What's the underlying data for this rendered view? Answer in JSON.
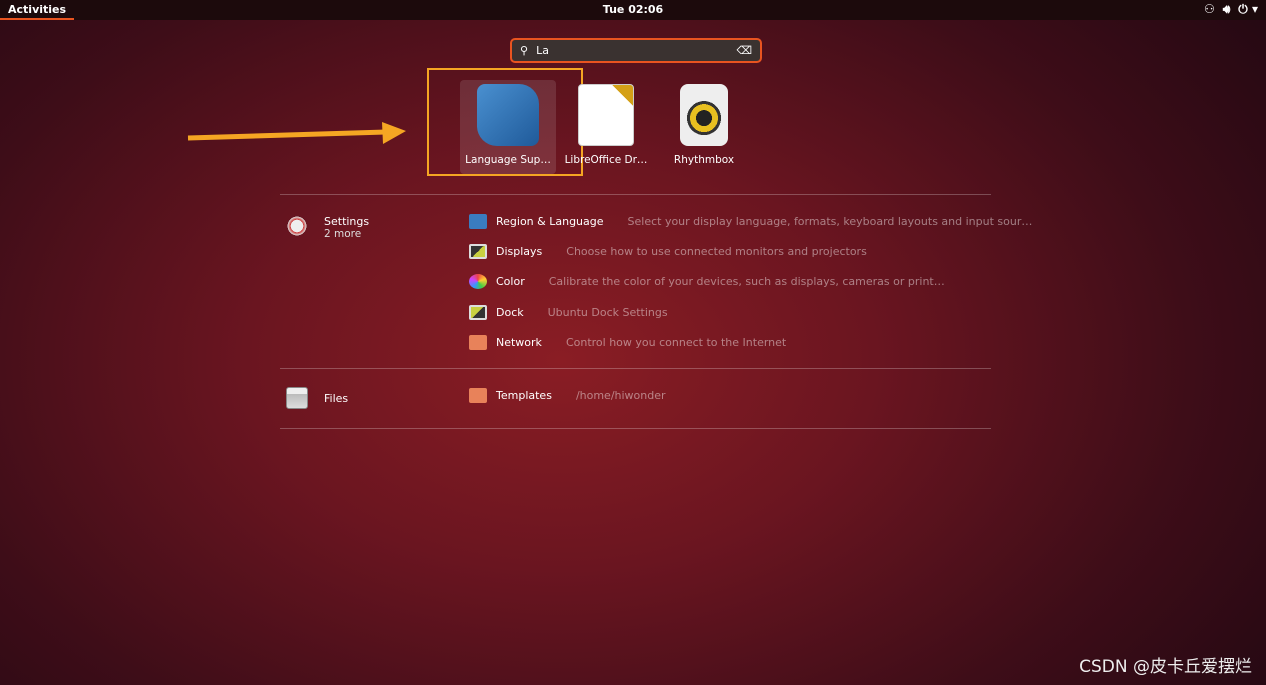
{
  "topbar": {
    "activities": "Activities",
    "clock": "Tue 02:06",
    "tray": {
      "network_icon": "network-icon",
      "volume_icon": "volume-icon",
      "power_icon": "power-icon"
    }
  },
  "search": {
    "value": "La"
  },
  "apps": [
    {
      "label": "Language Sup…",
      "icon": "language-support-icon",
      "selected": true
    },
    {
      "label": "LibreOffice Dr…",
      "icon": "libreoffice-draw-icon"
    },
    {
      "label": "Rhythmbox",
      "icon": "rhythmbox-icon"
    }
  ],
  "providers": [
    {
      "name": "Settings",
      "more": "2 more",
      "results": [
        {
          "title": "Region & Language",
          "desc": "Select your display language, formats, keyboard layouts and input sour…"
        },
        {
          "title": "Displays",
          "desc": "Choose how to use connected monitors and projectors"
        },
        {
          "title": "Color",
          "desc": "Calibrate the color of your devices, such as displays, cameras or print…"
        },
        {
          "title": "Dock",
          "desc": "Ubuntu Dock Settings"
        },
        {
          "title": "Network",
          "desc": "Control how you connect to the Internet"
        }
      ]
    },
    {
      "name": "Files",
      "results": [
        {
          "title": "Templates",
          "desc": "/home/hiwonder"
        }
      ]
    }
  ],
  "watermark": "CSDN @皮卡丘爱摆烂",
  "colors": {
    "accent": "#e95420",
    "highlight": "#f5a623"
  }
}
